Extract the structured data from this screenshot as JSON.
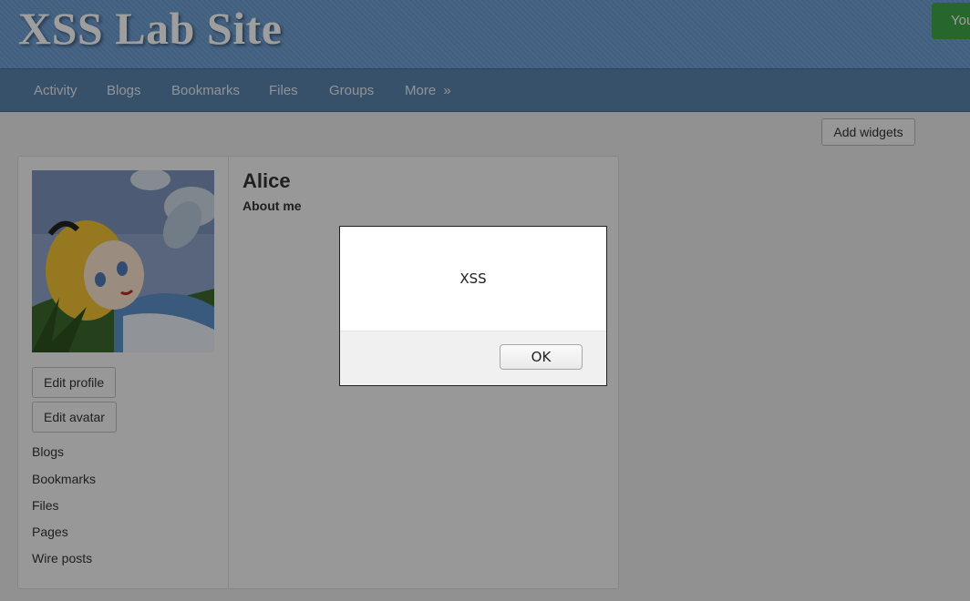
{
  "header": {
    "site_title": "XSS Lab Site",
    "login_button": "You"
  },
  "nav": {
    "items": [
      "Activity",
      "Blogs",
      "Bookmarks",
      "Files",
      "Groups",
      "More"
    ],
    "more_chevron": "»"
  },
  "toolbar": {
    "add_widgets": "Add widgets"
  },
  "profile": {
    "name": "Alice",
    "about_label": "About me",
    "edit_profile": "Edit profile",
    "edit_avatar": "Edit avatar",
    "links": [
      "Blogs",
      "Bookmarks",
      "Files",
      "Pages",
      "Wire posts"
    ]
  },
  "dialog": {
    "message": "XSS",
    "ok_label": "OK"
  },
  "colors": {
    "header_blue": "#6d9ed4",
    "nav_blue": "#5b83ad",
    "login_green": "#3fa54a"
  }
}
